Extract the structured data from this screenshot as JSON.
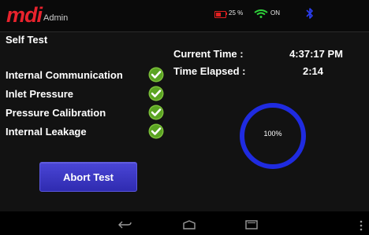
{
  "app": {
    "brand": "mdi",
    "user": "Admin",
    "accent": "#e8232d"
  },
  "status": {
    "battery": "25 %",
    "wifi": "ON",
    "battery_color": "#e32020",
    "wifi_color": "#2fd13a",
    "bt_color": "#2a3df0"
  },
  "page": {
    "title": "Self Test"
  },
  "timing": {
    "current_time_label": "Current Time :",
    "current_time_value": "4:37:17 PM",
    "elapsed_label": "Time Elapsed :",
    "elapsed_value": "2:14"
  },
  "tests": [
    {
      "label": "Internal Communication",
      "status": "pass"
    },
    {
      "label": "Inlet Pressure",
      "status": "pass"
    },
    {
      "label": "Pressure Calibration",
      "status": "pass"
    },
    {
      "label": "Internal Leakage",
      "status": "pass"
    }
  ],
  "progress": {
    "text": "100%",
    "value": 1.0,
    "ring_color": "#1f2be0"
  },
  "actions": {
    "abort_label": "Abort Test"
  },
  "nav": {
    "icons": [
      "back-icon",
      "home-icon",
      "recent-apps-icon",
      "menu-dots-icon"
    ]
  }
}
